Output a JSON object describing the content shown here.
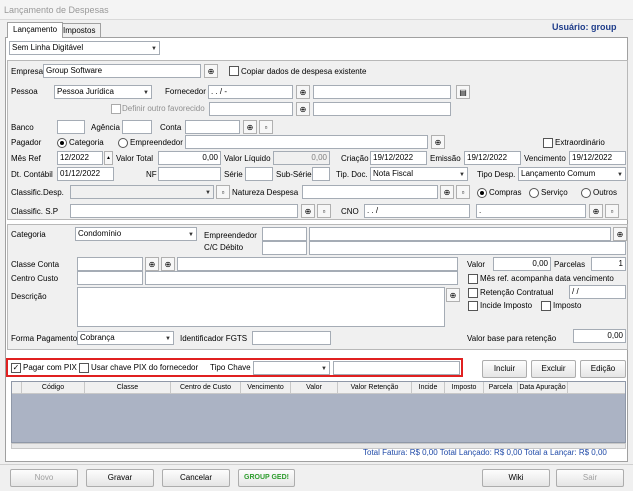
{
  "window": {
    "title": "Lançamento de Despesas"
  },
  "tabs": [
    {
      "label": "Lançamento"
    },
    {
      "label": "Impostos"
    }
  ],
  "user": "Usuário: group",
  "mode_select": "Sem Linha Digitável",
  "empresa": {
    "label": "Empresa",
    "value": "Group Software",
    "copy_label": "Copiar dados de despesa existente"
  },
  "pessoa": {
    "label": "Pessoa",
    "value": "Pessoa Jurídica",
    "fornecedor_label": "Fornecedor",
    "fornecedor_mask": " .   .   /   -",
    "definir_label": "Definir outro favorecido"
  },
  "banco": {
    "label": "Banco",
    "agencia_label": "Agência",
    "conta_label": "Conta"
  },
  "pagador": {
    "label": "Pagador",
    "categoria": "Categoria",
    "empreendedor": "Empreendedor",
    "extraordinario": "Extraordinário"
  },
  "mesref": {
    "label": "Mês Ref",
    "value": "12/2022",
    "valor_total_label": "Valor Total",
    "valor_total": "0,00",
    "valor_liquido_label": "Valor Líquido",
    "valor_liquido": "0,00",
    "criacao_label": "Criação",
    "criacao": "19/12/2022",
    "emissao_label": "Emissão",
    "emissao": "19/12/2022",
    "vencimento_label": "Vencimento",
    "vencimento": "19/12/2022"
  },
  "dtcontabil": {
    "label": "Dt. Contábil",
    "value": "01/12/2022",
    "nf_label": "NF",
    "serie_label": "Série",
    "subserie_label": "Sub-Série",
    "tipodoc_label": "Tip. Doc.",
    "tipodoc": "Nota Fiscal",
    "tipodesp_label": "Tipo Desp.",
    "tipodesp": "Lançamento Comum"
  },
  "classific": {
    "label": "Classific.Desp.",
    "natureza_label": "Natureza Despesa",
    "compras": "Compras",
    "servico": "Serviço",
    "outros": "Outros"
  },
  "classific_sp": {
    "label": "Classific. S.P",
    "cno_label": "CNO",
    "cno_mask": " .   .   /",
    "cno_mask2": " ."
  },
  "categoria": {
    "label": "Categoria",
    "value": "Condomínio",
    "empreendedor_label": "Empreendedor",
    "cc_debito_label": "C/C Débito"
  },
  "classe_conta": {
    "label": "Classe Conta",
    "centro_custo_label": "Centro Custo",
    "descricao_label": "Descrição"
  },
  "valor": {
    "label": "Valor",
    "value": "0,00",
    "parcelas_label": "Parcelas",
    "parcelas": "1"
  },
  "checks": {
    "mes_ref_acompanha": "Mês ref. acompanha data vencimento",
    "retencao": "Retenção Contratual",
    "retencao_mask": " / /",
    "incide_imposto": "Incide Imposto",
    "imposto": "Imposto"
  },
  "forma_pagamento": {
    "label": "Forma Pagamento",
    "value": "Cobrança",
    "ident_fgts_label": "Identificador FGTS",
    "valor_base_label": "Valor base para retenção",
    "valor_base": "0,00"
  },
  "pix": {
    "pagar_label": "Pagar com PIX",
    "usar_chave_label": "Usar chave PIX do fornecedor",
    "tipo_chave_label": "Tipo Chave"
  },
  "actions": {
    "incluir": "Incluir",
    "excluir": "Excluir",
    "edicao": "Edição"
  },
  "grid": {
    "columns": [
      "Código",
      "Classe",
      "Centro de Custo",
      "Vencimento",
      "Valor",
      "Valor Retenção",
      "Incide",
      "Imposto",
      "Parcela",
      "Data Apuração"
    ]
  },
  "totals": "Total Fatura: R$ 0,00   Total Lançado: R$ 0,00   Total a Lançar: R$ 0,00",
  "footer": {
    "novo": "Novo",
    "gravar": "Gravar",
    "cancelar": "Cancelar",
    "ged": "GROUP GED!",
    "wiki": "Wiki",
    "sair": "Sair"
  },
  "colors": {
    "highlight_border": "#e02020",
    "accent_blue": "#1e3c8a"
  }
}
